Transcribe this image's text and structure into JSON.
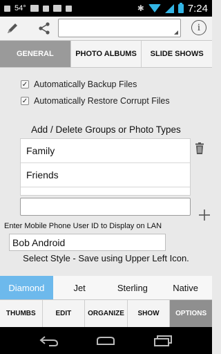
{
  "status_bar": {
    "temperature": "54°",
    "time": "7:24"
  },
  "toolbar": {
    "search_value": ""
  },
  "tabs": [
    {
      "label": "GENERAL",
      "active": true
    },
    {
      "label": "PHOTO ALBUMS",
      "active": false
    },
    {
      "label": "SLIDE SHOWS",
      "active": false
    }
  ],
  "options": {
    "auto_backup": {
      "label": "Automatically Backup Files",
      "checked": true
    },
    "auto_restore": {
      "label": "Automatically Restore Corrupt Files",
      "checked": true
    }
  },
  "groups": {
    "title": "Add / Delete Groups or Photo Types",
    "items": [
      "Family",
      "Friends"
    ],
    "new_value": ""
  },
  "user_id": {
    "label": "Enter Mobile Phone User ID to Display on LAN",
    "value": "Bob Android"
  },
  "style": {
    "title": "Select Style - Save using Upper Left Icon.",
    "options": [
      {
        "label": "Diamond",
        "active": true
      },
      {
        "label": "Jet",
        "active": false
      },
      {
        "label": "Sterling",
        "active": false
      },
      {
        "label": "Native",
        "active": false
      }
    ]
  },
  "bottom_tabs": [
    {
      "label": "THUMBS",
      "active": false
    },
    {
      "label": "EDIT",
      "active": false
    },
    {
      "label": "ORGANIZE",
      "active": false
    },
    {
      "label": "SHOW",
      "active": false
    },
    {
      "label": "OPTIONS",
      "active": true
    }
  ],
  "colors": {
    "accent": "#33b5e5",
    "style_active": "#6db9ec",
    "tab_active": "#9a9a9a"
  }
}
